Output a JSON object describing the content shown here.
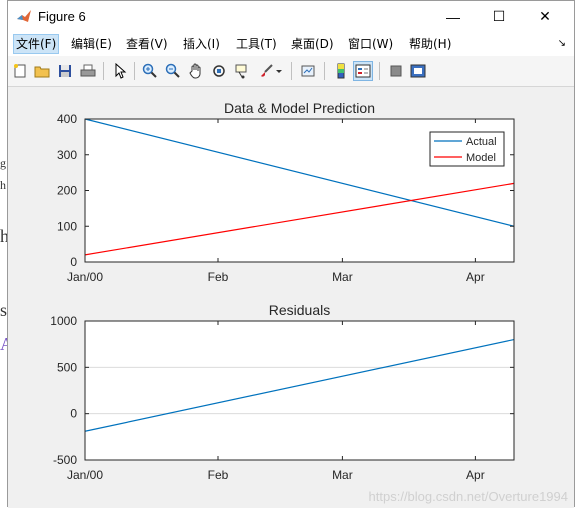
{
  "window": {
    "title": "Figure 6",
    "controls": {
      "minimize": "—",
      "maximize": "☐",
      "close": "✕"
    }
  },
  "menu": [
    "文件(F)",
    "编辑(E)",
    "查看(V)",
    "插入(I)",
    "工具(T)",
    "桌面(D)",
    "窗口(W)",
    "帮助(H)"
  ],
  "menu_corner": "↘",
  "background_page": {
    "fragments": [
      "g",
      "h",
      "h",
      "s",
      "A"
    ]
  },
  "toolbar_icons": [
    "new-figure-icon",
    "open-file-icon",
    "save-icon",
    "print-icon",
    "pointer-icon",
    "zoom-in-icon",
    "zoom-out-icon",
    "pan-icon",
    "rotate-3d-icon",
    "data-cursor-icon",
    "brush-icon",
    "brush-dropdown-icon",
    "link-plot-icon",
    "insert-colorbar-icon",
    "insert-legend-icon",
    "hide-plot-tools-icon",
    "show-plot-tools-icon"
  ],
  "watermark": "https://blog.csdn.net/Overture1994",
  "colors": {
    "actual": "#0072bd",
    "model": "#ff0000",
    "residuals": "#0072bd",
    "axes_bg": "#ffffff",
    "figure_bg": "#f0f0f0",
    "grid": "#dcdcdc"
  },
  "chart_data": [
    {
      "type": "line",
      "title": "Data & Model Prediction",
      "xlabel": "",
      "ylabel": "",
      "x_ticks": [
        "Jan/00",
        "Feb",
        "Mar",
        "Apr"
      ],
      "x": [
        "2000-01-01",
        "2000-04-10"
      ],
      "ylim": [
        0,
        400
      ],
      "y_ticks": [
        "0",
        "100",
        "200",
        "300",
        "400"
      ],
      "grid": false,
      "legend_position": "top-right",
      "series": [
        {
          "name": "Actual",
          "color": "#0072bd",
          "values": [
            400,
            100
          ]
        },
        {
          "name": "Model",
          "color": "#ff0000",
          "values": [
            20,
            220
          ]
        }
      ]
    },
    {
      "type": "line",
      "title": "Residuals",
      "xlabel": "",
      "ylabel": "",
      "x_ticks": [
        "Jan/00",
        "Feb",
        "Mar",
        "Apr"
      ],
      "x": [
        "2000-01-01",
        "2000-04-10"
      ],
      "ylim": [
        -500,
        1000
      ],
      "y_ticks": [
        "-500",
        "0",
        "500",
        "1000"
      ],
      "grid": true,
      "series": [
        {
          "color": "#0072bd",
          "values": [
            -190,
            800
          ]
        }
      ]
    }
  ]
}
